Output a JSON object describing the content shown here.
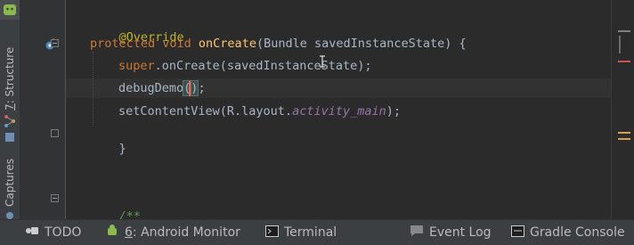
{
  "side_panel": {
    "structure_label_num": "7",
    "structure_label": ": Structure",
    "captures_label": "Captures"
  },
  "code": {
    "line1": "@Override",
    "line2_kw": "protected void ",
    "line2_fn": "onCreate",
    "line2_rest": "(Bundle savedInstanceState) {",
    "line3_kw": "super",
    "line3_rest": ".onCreate(savedInstanceState);",
    "line4_pre": "debugDemo",
    "line4_paren_open": "(",
    "line4_paren_close": ")",
    "line4_semicolon": ";",
    "line5_pre": "setContentView(R.layout.",
    "line5_field": "activity_main",
    "line5_post": ");",
    "line6": "}",
    "line7": "/**"
  },
  "scroll_marks": {
    "colors": [
      "#808080",
      "#c75450",
      "#c75450",
      "#d6a04b"
    ]
  },
  "bottom_bar": {
    "todo_label": "TODO",
    "android_monitor_num": "6",
    "android_monitor_label": ": Android Monitor",
    "terminal_label": "Terminal",
    "event_log_label": "Event Log",
    "gradle_console_label": "Gradle Console"
  },
  "colors": {
    "keyword": "#cc7832",
    "annotation": "#bbb529",
    "function": "#ffc66d",
    "text": "#a9b7c6",
    "field": "#9876aa",
    "comment": "#629755"
  }
}
